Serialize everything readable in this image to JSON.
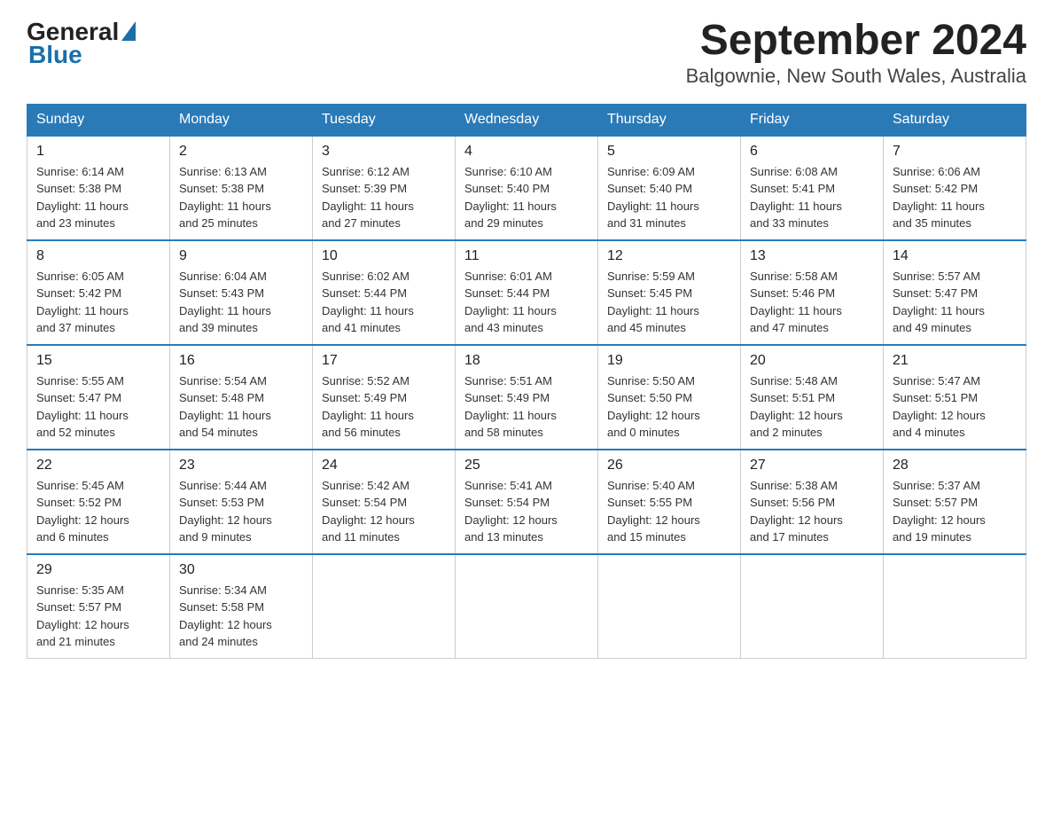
{
  "logo": {
    "general": "General",
    "blue": "Blue"
  },
  "title": "September 2024",
  "subtitle": "Balgownie, New South Wales, Australia",
  "days_of_week": [
    "Sunday",
    "Monday",
    "Tuesday",
    "Wednesday",
    "Thursday",
    "Friday",
    "Saturday"
  ],
  "weeks": [
    [
      {
        "num": "1",
        "sunrise": "6:14 AM",
        "sunset": "5:38 PM",
        "daylight": "11 hours and 23 minutes."
      },
      {
        "num": "2",
        "sunrise": "6:13 AM",
        "sunset": "5:38 PM",
        "daylight": "11 hours and 25 minutes."
      },
      {
        "num": "3",
        "sunrise": "6:12 AM",
        "sunset": "5:39 PM",
        "daylight": "11 hours and 27 minutes."
      },
      {
        "num": "4",
        "sunrise": "6:10 AM",
        "sunset": "5:40 PM",
        "daylight": "11 hours and 29 minutes."
      },
      {
        "num": "5",
        "sunrise": "6:09 AM",
        "sunset": "5:40 PM",
        "daylight": "11 hours and 31 minutes."
      },
      {
        "num": "6",
        "sunrise": "6:08 AM",
        "sunset": "5:41 PM",
        "daylight": "11 hours and 33 minutes."
      },
      {
        "num": "7",
        "sunrise": "6:06 AM",
        "sunset": "5:42 PM",
        "daylight": "11 hours and 35 minutes."
      }
    ],
    [
      {
        "num": "8",
        "sunrise": "6:05 AM",
        "sunset": "5:42 PM",
        "daylight": "11 hours and 37 minutes."
      },
      {
        "num": "9",
        "sunrise": "6:04 AM",
        "sunset": "5:43 PM",
        "daylight": "11 hours and 39 minutes."
      },
      {
        "num": "10",
        "sunrise": "6:02 AM",
        "sunset": "5:44 PM",
        "daylight": "11 hours and 41 minutes."
      },
      {
        "num": "11",
        "sunrise": "6:01 AM",
        "sunset": "5:44 PM",
        "daylight": "11 hours and 43 minutes."
      },
      {
        "num": "12",
        "sunrise": "5:59 AM",
        "sunset": "5:45 PM",
        "daylight": "11 hours and 45 minutes."
      },
      {
        "num": "13",
        "sunrise": "5:58 AM",
        "sunset": "5:46 PM",
        "daylight": "11 hours and 47 minutes."
      },
      {
        "num": "14",
        "sunrise": "5:57 AM",
        "sunset": "5:47 PM",
        "daylight": "11 hours and 49 minutes."
      }
    ],
    [
      {
        "num": "15",
        "sunrise": "5:55 AM",
        "sunset": "5:47 PM",
        "daylight": "11 hours and 52 minutes."
      },
      {
        "num": "16",
        "sunrise": "5:54 AM",
        "sunset": "5:48 PM",
        "daylight": "11 hours and 54 minutes."
      },
      {
        "num": "17",
        "sunrise": "5:52 AM",
        "sunset": "5:49 PM",
        "daylight": "11 hours and 56 minutes."
      },
      {
        "num": "18",
        "sunrise": "5:51 AM",
        "sunset": "5:49 PM",
        "daylight": "11 hours and 58 minutes."
      },
      {
        "num": "19",
        "sunrise": "5:50 AM",
        "sunset": "5:50 PM",
        "daylight": "12 hours and 0 minutes."
      },
      {
        "num": "20",
        "sunrise": "5:48 AM",
        "sunset": "5:51 PM",
        "daylight": "12 hours and 2 minutes."
      },
      {
        "num": "21",
        "sunrise": "5:47 AM",
        "sunset": "5:51 PM",
        "daylight": "12 hours and 4 minutes."
      }
    ],
    [
      {
        "num": "22",
        "sunrise": "5:45 AM",
        "sunset": "5:52 PM",
        "daylight": "12 hours and 6 minutes."
      },
      {
        "num": "23",
        "sunrise": "5:44 AM",
        "sunset": "5:53 PM",
        "daylight": "12 hours and 9 minutes."
      },
      {
        "num": "24",
        "sunrise": "5:42 AM",
        "sunset": "5:54 PM",
        "daylight": "12 hours and 11 minutes."
      },
      {
        "num": "25",
        "sunrise": "5:41 AM",
        "sunset": "5:54 PM",
        "daylight": "12 hours and 13 minutes."
      },
      {
        "num": "26",
        "sunrise": "5:40 AM",
        "sunset": "5:55 PM",
        "daylight": "12 hours and 15 minutes."
      },
      {
        "num": "27",
        "sunrise": "5:38 AM",
        "sunset": "5:56 PM",
        "daylight": "12 hours and 17 minutes."
      },
      {
        "num": "28",
        "sunrise": "5:37 AM",
        "sunset": "5:57 PM",
        "daylight": "12 hours and 19 minutes."
      }
    ],
    [
      {
        "num": "29",
        "sunrise": "5:35 AM",
        "sunset": "5:57 PM",
        "daylight": "12 hours and 21 minutes."
      },
      {
        "num": "30",
        "sunrise": "5:34 AM",
        "sunset": "5:58 PM",
        "daylight": "12 hours and 24 minutes."
      },
      null,
      null,
      null,
      null,
      null
    ]
  ],
  "labels": {
    "sunrise": "Sunrise:",
    "sunset": "Sunset:",
    "daylight": "Daylight:"
  }
}
